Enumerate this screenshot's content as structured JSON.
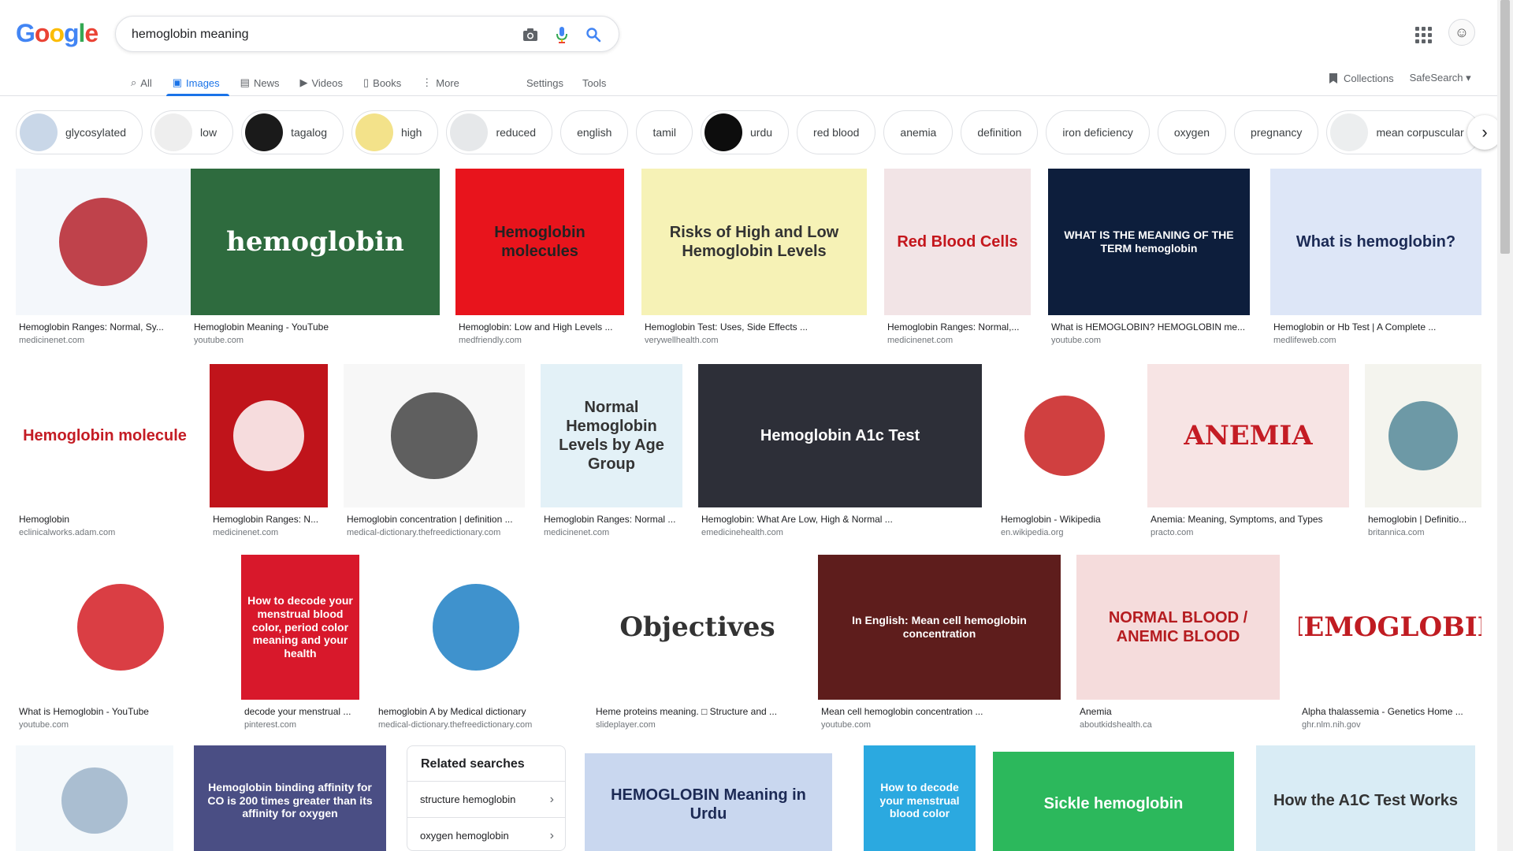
{
  "logo": {
    "letters": [
      "G",
      "o",
      "o",
      "g",
      "l",
      "e"
    ],
    "colors": [
      "#4285F4",
      "#EA4335",
      "#FBBC05",
      "#4285F4",
      "#34A853",
      "#EA4335"
    ]
  },
  "search": {
    "query": "hemoglobin meaning"
  },
  "icons": {
    "camera": "camera-icon",
    "mic": "microphone-icon",
    "search": "search-icon",
    "apps": "apps-grid-icon",
    "collections": "bookmark-icon"
  },
  "tabs": [
    {
      "label": "All",
      "icon": "search-icon",
      "active": false
    },
    {
      "label": "Images",
      "icon": "image-icon",
      "active": true
    },
    {
      "label": "News",
      "icon": "news-icon",
      "active": false
    },
    {
      "label": "Videos",
      "icon": "video-icon",
      "active": false
    },
    {
      "label": "Books",
      "icon": "book-icon",
      "active": false
    },
    {
      "label": "More",
      "icon": "more-vertical-icon",
      "active": false
    }
  ],
  "tools": {
    "settings": "Settings",
    "tools": "Tools"
  },
  "right_tools": {
    "collections": "Collections",
    "safesearch": "SafeSearch"
  },
  "chips": [
    {
      "label": "glycosylated",
      "thumb": true,
      "color": "#c9d7e8"
    },
    {
      "label": "low",
      "thumb": true,
      "color": "#eeeeee"
    },
    {
      "label": "tagalog",
      "thumb": true,
      "color": "#1a1a1a"
    },
    {
      "label": "high",
      "thumb": true,
      "color": "#f3e28a"
    },
    {
      "label": "reduced",
      "thumb": true,
      "color": "#e6e8ea"
    },
    {
      "label": "english",
      "thumb": false
    },
    {
      "label": "tamil",
      "thumb": false
    },
    {
      "label": "urdu",
      "thumb": true,
      "color": "#0d0d0d"
    },
    {
      "label": "red blood",
      "thumb": false
    },
    {
      "label": "anemia",
      "thumb": false
    },
    {
      "label": "definition",
      "thumb": false
    },
    {
      "label": "iron deficiency",
      "thumb": false
    },
    {
      "label": "oxygen",
      "thumb": false
    },
    {
      "label": "pregnancy",
      "thumb": false
    },
    {
      "label": "mean corpuscular",
      "thumb": true,
      "color": "#eceeef"
    }
  ],
  "results": [
    {
      "caption": "Hemoglobin Ranges: Normal, Sy...",
      "source": "medicinenet.com",
      "bg": "#f4f7fb",
      "fg": "#b5222b",
      "text": ""
    },
    {
      "caption": "Hemoglobin Meaning - YouTube",
      "source": "youtube.com",
      "bg": "#2e6b3e",
      "fg": "#ffffff",
      "text": "hemoglobin"
    },
    {
      "caption": "Hemoglobin: Low and High Levels ...",
      "source": "medfriendly.com",
      "bg": "#e8141c",
      "fg": "#222222",
      "text": "Hemoglobin molecules"
    },
    {
      "caption": "Hemoglobin Test: Uses, Side Effects ...",
      "source": "verywellhealth.com",
      "bg": "#f6f2b6",
      "fg": "#333333",
      "text": "Risks of High and Low Hemoglobin Levels"
    },
    {
      "caption": "Hemoglobin Ranges: Normal,...",
      "source": "medicinenet.com",
      "bg": "#f2e4e6",
      "fg": "#c4161c",
      "text": "Red Blood Cells"
    },
    {
      "caption": "What is HEMOGLOBIN? HEMOGLOBIN me...",
      "source": "youtube.com",
      "bg": "#0d1e3c",
      "fg": "#ffffff",
      "text": "WHAT IS THE MEANING OF THE TERM hemoglobin"
    },
    {
      "caption": "Hemoglobin or Hb Test | A Complete ...",
      "source": "medlifeweb.com",
      "bg": "#dde6f7",
      "fg": "#1b2a55",
      "text": "What is hemoglobin?"
    },
    {
      "caption": "Hemoglobin",
      "source": "eclinicalworks.adam.com",
      "bg": "#ffffff",
      "fg": "#c41c24",
      "text": "Hemoglobin molecule"
    },
    {
      "caption": "Hemoglobin Ranges: N...",
      "source": "medicinenet.com",
      "bg": "#c0141b",
      "fg": "#ffffff",
      "text": ""
    },
    {
      "caption": "Hemoglobin concentration | definition ...",
      "source": "medical-dictionary.thefreedictionary.com",
      "bg": "#f7f7f7",
      "fg": "#444444",
      "text": ""
    },
    {
      "caption": "Hemoglobin Ranges: Normal ...",
      "source": "medicinenet.com",
      "bg": "#e3f1f7",
      "fg": "#333333",
      "text": "Normal Hemoglobin Levels by Age Group"
    },
    {
      "caption": "Hemoglobin: What Are Low, High & Normal ...",
      "source": "emedicinehealth.com",
      "bg": "#2d2f38",
      "fg": "#ffffff",
      "text": "Hemoglobin A1c Test"
    },
    {
      "caption": "Hemoglobin - Wikipedia",
      "source": "en.wikipedia.org",
      "bg": "#ffffff",
      "fg": "#c81e1e",
      "text": ""
    },
    {
      "caption": "Anemia: Meaning, Symptoms, and Types",
      "source": "practo.com",
      "bg": "#f7e4e4",
      "fg": "#c41c24",
      "text": "ANEMIA"
    },
    {
      "caption": "hemoglobin | Definitio...",
      "source": "britannica.com",
      "bg": "#f4f4ee",
      "fg": "#558899",
      "text": ""
    },
    {
      "caption": "What is Hemoglobin - YouTube",
      "source": "youtube.com",
      "bg": "#ffffff",
      "fg": "#d31c23",
      "text": ""
    },
    {
      "caption": "decode your menstrual ...",
      "source": "pinterest.com",
      "bg": "#d8182b",
      "fg": "#ffffff",
      "text": "How to decode your menstrual blood color, period color meaning and your health"
    },
    {
      "caption": "hemoglobin A by Medical dictionary",
      "source": "medical-dictionary.thefreedictionary.com",
      "bg": "#ffffff",
      "fg": "#1d7fc4",
      "text": ""
    },
    {
      "caption": "Heme proteins meaning. □ Structure and ...",
      "source": "slideplayer.com",
      "bg": "#ffffff",
      "fg": "#333333",
      "text": "Objectives"
    },
    {
      "caption": "Mean cell hemoglobin concentration ...",
      "source": "youtube.com",
      "bg": "#5e1d1c",
      "fg": "#ffffff",
      "text": "In English: Mean cell hemoglobin concentration"
    },
    {
      "caption": "Anemia",
      "source": "aboutkidshealth.ca",
      "bg": "#f5dcdc",
      "fg": "#b51c20",
      "text": "NORMAL BLOOD / ANEMIC BLOOD"
    },
    {
      "caption": "Alpha thalassemia - Genetics Home ...",
      "source": "ghr.nlm.nih.gov",
      "bg": "#ffffff",
      "fg": "#c01c22",
      "text": "HEMOGLOBIN"
    },
    {
      "caption": "",
      "source": "",
      "bg": "#f4f8fb",
      "fg": "#9cb4c9",
      "text": ""
    },
    {
      "caption": "",
      "source": "",
      "bg": "#4a4e84",
      "fg": "#ffffff",
      "text": "Hemoglobin binding affinity for CO is 200 times greater than its affinity for oxygen"
    },
    {
      "caption": "",
      "source": "",
      "bg": "#c9d7ef",
      "fg": "#1c2a55",
      "text": "HEMOGLOBIN Meaning in Urdu"
    },
    {
      "caption": "",
      "source": "",
      "bg": "#2ba9e0",
      "fg": "#ffffff",
      "text": "How to decode your menstrual blood color"
    },
    {
      "caption": "",
      "source": "",
      "bg": "#2cb85c",
      "fg": "#ffffff",
      "text": "Sickle hemoglobin"
    },
    {
      "caption": "",
      "source": "",
      "bg": "#d9ecf5",
      "fg": "#333333",
      "text": "How the A1C Test Works"
    }
  ],
  "related": {
    "title": "Related searches",
    "items": [
      "structure hemoglobin",
      "oxygen hemoglobin"
    ]
  }
}
